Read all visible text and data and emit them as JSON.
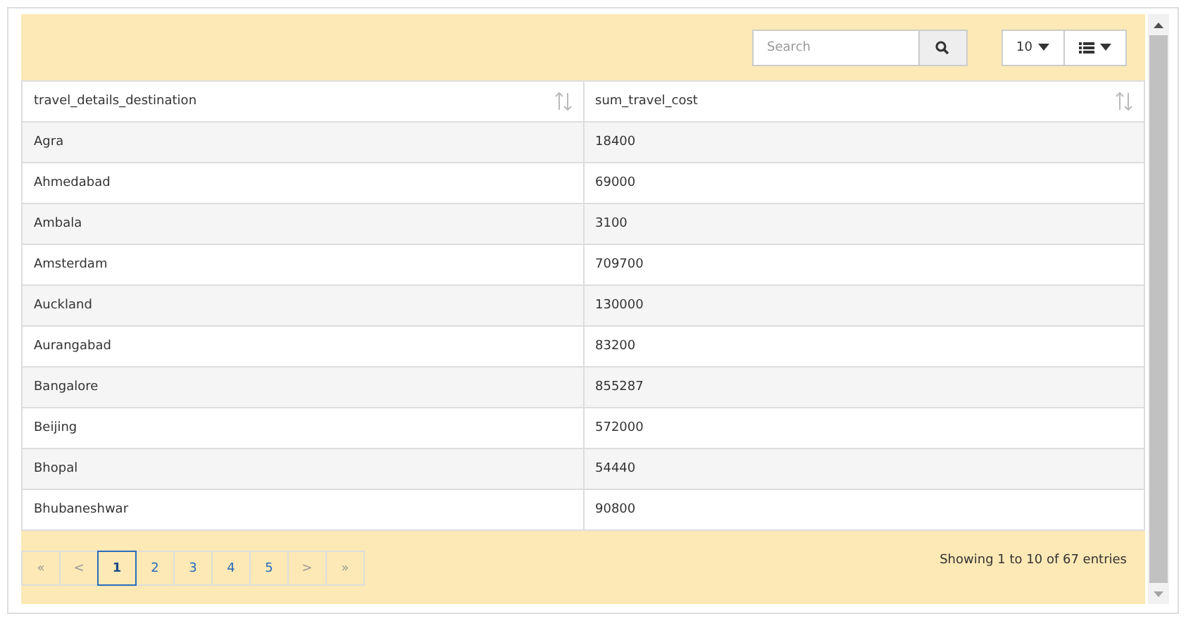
{
  "toolbar": {
    "search": {
      "placeholder": "Search"
    },
    "page_size": "10"
  },
  "table": {
    "columns": [
      "travel_details_destination",
      "sum_travel_cost"
    ],
    "rows": [
      [
        "Agra",
        "18400"
      ],
      [
        "Ahmedabad",
        "69000"
      ],
      [
        "Ambala",
        "3100"
      ],
      [
        "Amsterdam",
        "709700"
      ],
      [
        "Auckland",
        "130000"
      ],
      [
        "Aurangabad",
        "83200"
      ],
      [
        "Bangalore",
        "855287"
      ],
      [
        "Beijing",
        "572000"
      ],
      [
        "Bhopal",
        "54440"
      ],
      [
        "Bhubaneshwar",
        "90800"
      ]
    ]
  },
  "pagination": {
    "pages": [
      {
        "label": "«",
        "kind": "nav",
        "selected": false
      },
      {
        "label": "<",
        "kind": "nav",
        "selected": false
      },
      {
        "label": "1",
        "kind": "page",
        "selected": true
      },
      {
        "label": "2",
        "kind": "page",
        "selected": false
      },
      {
        "label": "3",
        "kind": "page",
        "selected": false
      },
      {
        "label": "4",
        "kind": "page",
        "selected": false
      },
      {
        "label": "5",
        "kind": "page",
        "selected": false
      },
      {
        "label": ">",
        "kind": "nav",
        "selected": false
      },
      {
        "label": "»",
        "kind": "nav",
        "selected": false
      }
    ],
    "info": "Showing 1 to 10 of 67 entries"
  }
}
